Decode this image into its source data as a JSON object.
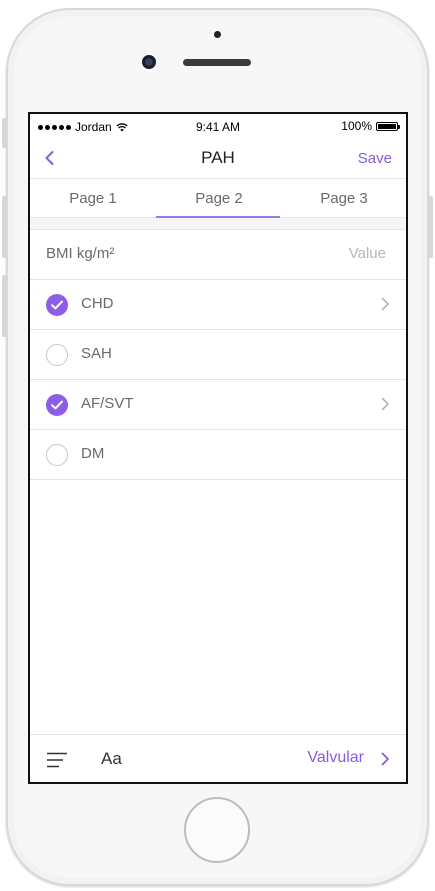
{
  "status_bar": {
    "carrier": "Jordan",
    "time": "9:41 AM",
    "battery": "100%"
  },
  "nav": {
    "title": "PAH",
    "save_label": "Save"
  },
  "tabs": [
    {
      "label": "Page 1"
    },
    {
      "label": "Page 2"
    },
    {
      "label": "Page 3"
    }
  ],
  "active_tab": "Page 2",
  "form": {
    "bmi": {
      "label": "BMI kg/m²",
      "placeholder": "Value",
      "value": ""
    },
    "items": [
      {
        "label": "CHD",
        "checked": true,
        "has_detail": true
      },
      {
        "label": "SAH",
        "checked": false,
        "has_detail": false
      },
      {
        "label": "AF/SVT",
        "checked": true,
        "has_detail": true
      },
      {
        "label": "DM",
        "checked": false,
        "has_detail": false
      }
    ]
  },
  "bottom_bar": {
    "font_label": "Aa",
    "calculate_label": "Valvular"
  },
  "colors": {
    "accent": "#8e5de8",
    "accent_text": "#8a5bd6",
    "divider": "#e6e6e6",
    "label_text": "#6a6a6a"
  },
  "icons": {
    "back": "chevron-left-icon",
    "check": "checkmark-icon",
    "detail": "chevron-right-icon",
    "menu": "menu-lines-icon"
  }
}
